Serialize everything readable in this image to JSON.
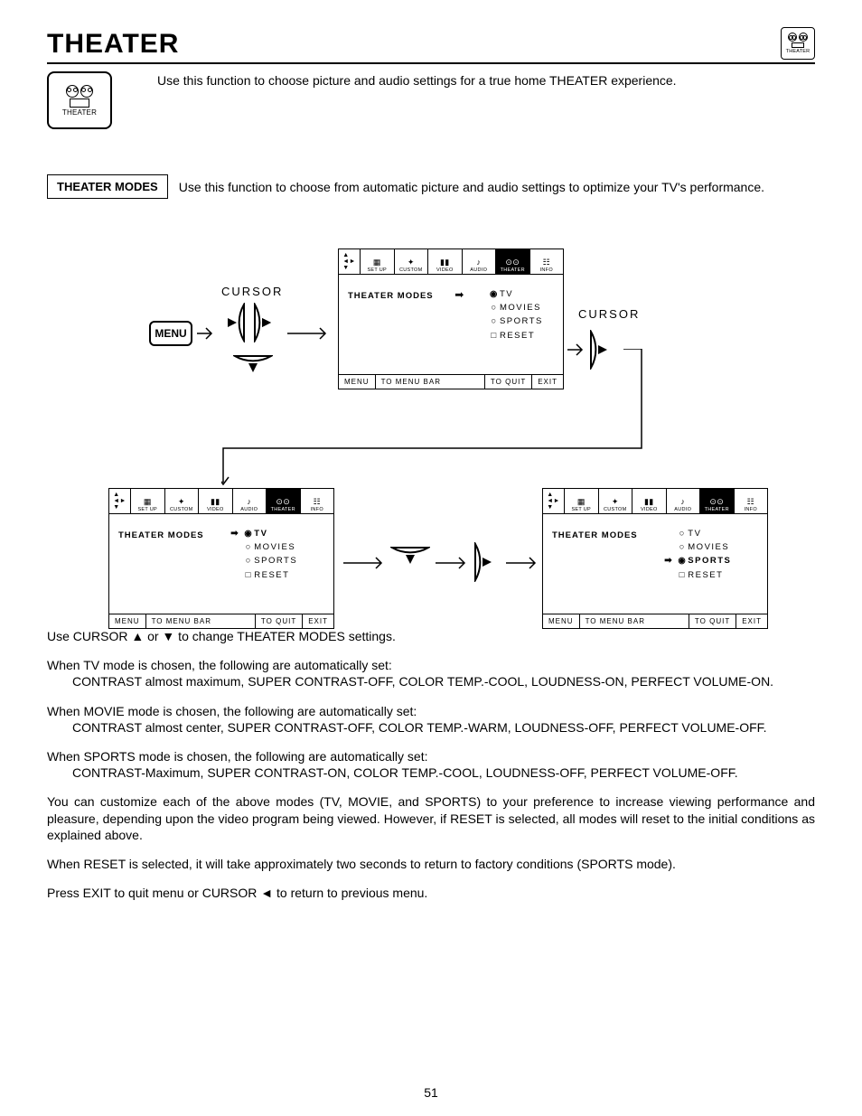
{
  "header": {
    "title": "THEATER",
    "icon_label": "THEATER"
  },
  "intro": {
    "text": "Use this function to choose picture and audio settings for a true home THEATER experience."
  },
  "modes_section": {
    "label": "THEATER MODES",
    "desc": "Use this function to choose from automatic picture and audio settings to optimize your TV's performance."
  },
  "menu": {
    "tabs": {
      "setup": "SET UP",
      "custom": "CUSTOM",
      "video": "VIDEO",
      "audio": "AUDIO",
      "theater": "THEATER",
      "info": "INFO"
    },
    "heading": "THEATER MODES",
    "options": {
      "tv": "TV",
      "movies": "MOVIES",
      "sports": "SPORTS",
      "reset": "RESET"
    },
    "footer": {
      "menu": "MENU",
      "to_menu_bar": "TO MENU BAR",
      "to_quit": "TO QUIT",
      "exit": "EXIT"
    }
  },
  "nav": {
    "menu_label": "MENU",
    "cursor_label": "CURSOR"
  },
  "body": {
    "p1": "Use CURSOR ▲ or ▼ to change THEATER MODES settings.",
    "p2a": "When TV mode is chosen, the following are automatically set:",
    "p2b": "CONTRAST almost maximum, SUPER CONTRAST-OFF, COLOR TEMP.-COOL, LOUDNESS-ON, PERFECT VOLUME-ON.",
    "p3a": "When MOVIE mode is chosen, the following are automatically set:",
    "p3b": "CONTRAST almost center, SUPER CONTRAST-OFF, COLOR TEMP.-WARM, LOUDNESS-OFF, PERFECT VOLUME-OFF.",
    "p4a": "When SPORTS mode is chosen, the following are automatically set:",
    "p4b": "CONTRAST-Maximum, SUPER CONTRAST-ON, COLOR TEMP.-COOL, LOUDNESS-OFF, PERFECT VOLUME-OFF.",
    "p5": "You can customize each of the above modes (TV, MOVIE, and SPORTS) to your preference to increase viewing performance and pleasure, depending upon the video program being viewed. However, if RESET is selected, all modes will reset to the initial conditions as explained above.",
    "p6": "When RESET is selected, it will take approximately two seconds to return to factory conditions (SPORTS mode).",
    "p7": "Press EXIT to quit menu or CURSOR ◄ to return to previous menu."
  },
  "page_number": "51"
}
